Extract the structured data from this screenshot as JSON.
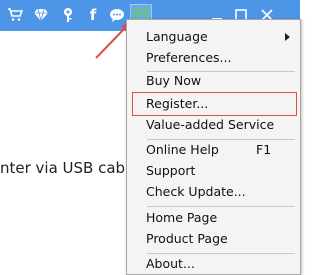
{
  "titlebar": {
    "icons": [
      "cart-icon",
      "diamond-icon",
      "key-icon",
      "facebook-icon",
      "chat-icon",
      "menu-icon",
      "minimize-icon",
      "maximize-icon",
      "close-icon"
    ],
    "facebook_glyph": "f",
    "colors": {
      "bar": "#4d95e6",
      "icon": "#ffffff"
    }
  },
  "background": {
    "text": "nter via USB cable"
  },
  "menu": {
    "items": [
      {
        "label": "Language",
        "has_submenu": true
      },
      {
        "label": "Preferences..."
      },
      {
        "label": "Buy Now"
      },
      {
        "label": "Register...",
        "highlighted": true
      },
      {
        "label": "Value-added Service"
      },
      {
        "label": "Online Help",
        "shortcut": "F1"
      },
      {
        "label": "Support"
      },
      {
        "label": "Check Update..."
      },
      {
        "label": "Home Page"
      },
      {
        "label": "Product Page"
      },
      {
        "label": "About..."
      }
    ]
  },
  "annotation": {
    "color": "#e34b4b"
  }
}
